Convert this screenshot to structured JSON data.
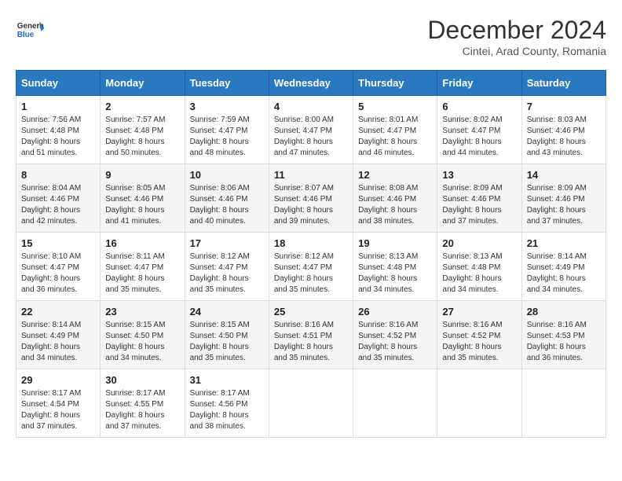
{
  "logo": {
    "general": "General",
    "blue": "Blue"
  },
  "title": "December 2024",
  "subtitle": "Cintei, Arad County, Romania",
  "days_header": [
    "Sunday",
    "Monday",
    "Tuesday",
    "Wednesday",
    "Thursday",
    "Friday",
    "Saturday"
  ],
  "weeks": [
    [
      {
        "day": "1",
        "sunrise": "7:56 AM",
        "sunset": "4:48 PM",
        "daylight": "8 hours and 51 minutes."
      },
      {
        "day": "2",
        "sunrise": "7:57 AM",
        "sunset": "4:48 PM",
        "daylight": "8 hours and 50 minutes."
      },
      {
        "day": "3",
        "sunrise": "7:59 AM",
        "sunset": "4:47 PM",
        "daylight": "8 hours and 48 minutes."
      },
      {
        "day": "4",
        "sunrise": "8:00 AM",
        "sunset": "4:47 PM",
        "daylight": "8 hours and 47 minutes."
      },
      {
        "day": "5",
        "sunrise": "8:01 AM",
        "sunset": "4:47 PM",
        "daylight": "8 hours and 46 minutes."
      },
      {
        "day": "6",
        "sunrise": "8:02 AM",
        "sunset": "4:47 PM",
        "daylight": "8 hours and 44 minutes."
      },
      {
        "day": "7",
        "sunrise": "8:03 AM",
        "sunset": "4:46 PM",
        "daylight": "8 hours and 43 minutes."
      }
    ],
    [
      {
        "day": "8",
        "sunrise": "8:04 AM",
        "sunset": "4:46 PM",
        "daylight": "8 hours and 42 minutes."
      },
      {
        "day": "9",
        "sunrise": "8:05 AM",
        "sunset": "4:46 PM",
        "daylight": "8 hours and 41 minutes."
      },
      {
        "day": "10",
        "sunrise": "8:06 AM",
        "sunset": "4:46 PM",
        "daylight": "8 hours and 40 minutes."
      },
      {
        "day": "11",
        "sunrise": "8:07 AM",
        "sunset": "4:46 PM",
        "daylight": "8 hours and 39 minutes."
      },
      {
        "day": "12",
        "sunrise": "8:08 AM",
        "sunset": "4:46 PM",
        "daylight": "8 hours and 38 minutes."
      },
      {
        "day": "13",
        "sunrise": "8:09 AM",
        "sunset": "4:46 PM",
        "daylight": "8 hours and 37 minutes."
      },
      {
        "day": "14",
        "sunrise": "8:09 AM",
        "sunset": "4:46 PM",
        "daylight": "8 hours and 37 minutes."
      }
    ],
    [
      {
        "day": "15",
        "sunrise": "8:10 AM",
        "sunset": "4:47 PM",
        "daylight": "8 hours and 36 minutes."
      },
      {
        "day": "16",
        "sunrise": "8:11 AM",
        "sunset": "4:47 PM",
        "daylight": "8 hours and 35 minutes."
      },
      {
        "day": "17",
        "sunrise": "8:12 AM",
        "sunset": "4:47 PM",
        "daylight": "8 hours and 35 minutes."
      },
      {
        "day": "18",
        "sunrise": "8:12 AM",
        "sunset": "4:47 PM",
        "daylight": "8 hours and 35 minutes."
      },
      {
        "day": "19",
        "sunrise": "8:13 AM",
        "sunset": "4:48 PM",
        "daylight": "8 hours and 34 minutes."
      },
      {
        "day": "20",
        "sunrise": "8:13 AM",
        "sunset": "4:48 PM",
        "daylight": "8 hours and 34 minutes."
      },
      {
        "day": "21",
        "sunrise": "8:14 AM",
        "sunset": "4:49 PM",
        "daylight": "8 hours and 34 minutes."
      }
    ],
    [
      {
        "day": "22",
        "sunrise": "8:14 AM",
        "sunset": "4:49 PM",
        "daylight": "8 hours and 34 minutes."
      },
      {
        "day": "23",
        "sunrise": "8:15 AM",
        "sunset": "4:50 PM",
        "daylight": "8 hours and 34 minutes."
      },
      {
        "day": "24",
        "sunrise": "8:15 AM",
        "sunset": "4:50 PM",
        "daylight": "8 hours and 35 minutes."
      },
      {
        "day": "25",
        "sunrise": "8:16 AM",
        "sunset": "4:51 PM",
        "daylight": "8 hours and 35 minutes."
      },
      {
        "day": "26",
        "sunrise": "8:16 AM",
        "sunset": "4:52 PM",
        "daylight": "8 hours and 35 minutes."
      },
      {
        "day": "27",
        "sunrise": "8:16 AM",
        "sunset": "4:52 PM",
        "daylight": "8 hours and 35 minutes."
      },
      {
        "day": "28",
        "sunrise": "8:16 AM",
        "sunset": "4:53 PM",
        "daylight": "8 hours and 36 minutes."
      }
    ],
    [
      {
        "day": "29",
        "sunrise": "8:17 AM",
        "sunset": "4:54 PM",
        "daylight": "8 hours and 37 minutes."
      },
      {
        "day": "30",
        "sunrise": "8:17 AM",
        "sunset": "4:55 PM",
        "daylight": "8 hours and 37 minutes."
      },
      {
        "day": "31",
        "sunrise": "8:17 AM",
        "sunset": "4:56 PM",
        "daylight": "8 hours and 38 minutes."
      },
      null,
      null,
      null,
      null
    ]
  ]
}
